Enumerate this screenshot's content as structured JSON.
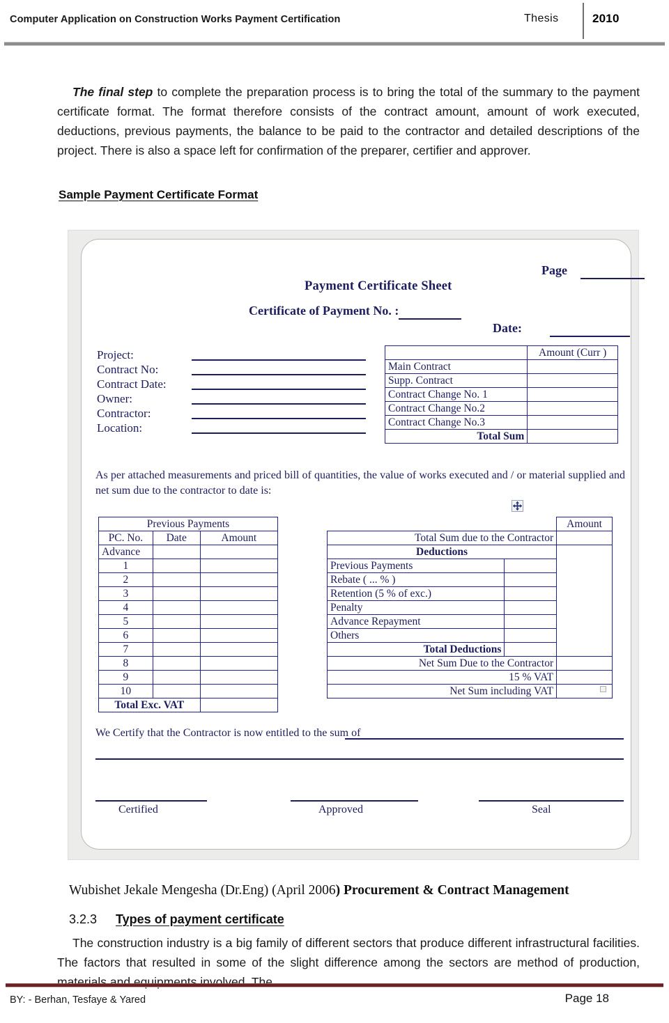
{
  "header": {
    "running_title": "Computer Application on Construction Works Payment Certification",
    "doc_type": "Thesis",
    "year": "2010"
  },
  "main": {
    "paragraph_1_lead": "The final step",
    "paragraph_1": " to complete the preparation process is to bring the total of the summary to the payment certificate format. The format therefore consists of the contract amount, amount of work executed, deductions, previous payments, the balance to be paid to the contractor and detailed descriptions of the project. There is also a space left for confirmation of the preparer, certifier and approver.",
    "sample_heading": "Sample Payment Certificate Format",
    "citation_plain": "Wubishet Jekale Mengesha (Dr.Eng) (April 2006",
    "citation_bold": ") Procurement & Contract Management",
    "section_number": "3.2.3",
    "section_title": "Types of payment certificate",
    "paragraph_2": "The construction industry is a big family of different sectors that produce different infrastructural facilities. The factors that resulted in some of the slight difference among the sectors are method of production, materials and equipments involved. The"
  },
  "certificate_form": {
    "title": "Payment Certificate Sheet",
    "certificate_no_label": "Certificate of Payment No. :",
    "page_label": "Page",
    "date_label": "Date:",
    "project_fields": [
      "Project:",
      "Contract No:",
      "Contract Date:",
      "Owner:",
      "Contractor:",
      "Location:"
    ],
    "contract_table": {
      "amount_header": "Amount (Curr )",
      "rows": [
        "Main Contract",
        "Supp. Contract",
        "Contract Change No. 1",
        "Contract Change No.2",
        "Contract Change No.3"
      ],
      "total_row": "Total Sum"
    },
    "narrative": "As per attached measurements and priced bill of quantities, the value of works executed and / or material supplied and net sum due to the contractor to date is:",
    "previous_payments": {
      "title": "Previous Payments",
      "columns": [
        "PC. No.",
        "Date",
        "Amount"
      ],
      "rows": [
        "Advance",
        "1",
        "2",
        "3",
        "4",
        "5",
        "6",
        "7",
        "8",
        "9",
        "10"
      ],
      "total_row": "Total Exc. VAT"
    },
    "deductions_table": {
      "amount_header": "Amount",
      "total_sum_due": "Total Sum due to the Contractor",
      "deductions_header": "Deductions",
      "deduction_rows": [
        "Previous Payments",
        "Rebate ( ... % )",
        "Retention (5 % of exc.)",
        "Penalty",
        "Advance Repayment",
        "Others"
      ],
      "total_deductions": "Total Deductions",
      "net_sum_due": "Net Sum Due to the Contractor",
      "vat_row": "15 % VAT",
      "net_sum_incl_vat": "Net Sum including VAT"
    },
    "certify_text": "We Certify that the Contractor is now entitled to the sum of",
    "signatures": [
      "Certified",
      "Approved",
      "Seal"
    ]
  },
  "footer": {
    "authors": "BY: - Berhan, Tesfaye & Yared",
    "page_number": "Page 18"
  },
  "colors": {
    "form_ink": "#1d1d5e",
    "header_rule": "#8c8c8c",
    "footer_rule": "#6b2224"
  }
}
